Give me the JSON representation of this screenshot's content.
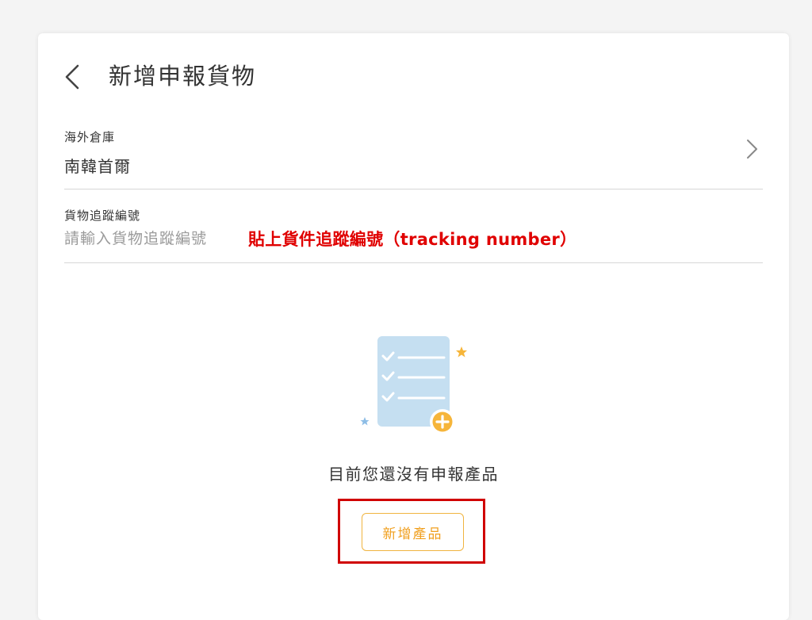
{
  "header": {
    "title": "新增申報貨物",
    "back_icon": "chevron-left-icon"
  },
  "warehouse": {
    "label": "海外倉庫",
    "value": "南韓首爾",
    "icon": "chevron-right-icon"
  },
  "tracking": {
    "label": "貨物追蹤編號",
    "placeholder": "請輸入貨物追蹤編號",
    "value": "",
    "annotation": "貼上貨件追蹤編號（tracking number）"
  },
  "empty_state": {
    "illustration": "checklist-add-icon",
    "message": "目前您還沒有申報產品",
    "add_button_label": "新增產品"
  },
  "colors": {
    "background": "#f4f4f4",
    "card": "#ffffff",
    "accent_orange": "#f0a020",
    "annotation_red": "#e00000",
    "illustration_blue": "#c5dff1",
    "divider": "#d7d7d7"
  }
}
